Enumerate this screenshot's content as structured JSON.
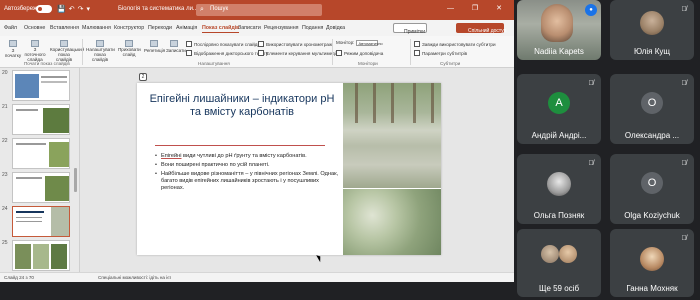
{
  "titlebar": {
    "autosave_label": "Автозбереження",
    "doc_title": "Біологія та систематика ли...",
    "search_placeholder": "Пошук",
    "window_controls": "— ❐ ✕"
  },
  "tabs": {
    "items": [
      "Файл",
      "Основне",
      "Вставлення",
      "Малювання",
      "Конструктор",
      "Переходи",
      "Анімація",
      "Показ слайдів",
      "Записати",
      "Рецензування",
      "Подання",
      "Довідка"
    ],
    "active": "Показ слайдів",
    "comments_label": "Примітки",
    "share_label": "Спільний доступ"
  },
  "ribbon": {
    "items": [
      "З початку",
      "З поточного слайда",
      "Користувацький показ слайдів",
      "Налаштувати показ слайдів",
      "Приховати слайд",
      "Репетиція",
      "Записати"
    ],
    "checkboxes": [
      "Послідовно показувати слайди",
      "Відображення дикторського тексту",
      "Використовувати хронометраж",
      "Елементи керування мультимедіа"
    ],
    "monitor_label": "Монітор:",
    "monitor_value": "Автоматично",
    "presenter_view": "Режим доповідача",
    "subtitles": [
      "Завжди використовувати субтитри",
      "Параметри субтитрів"
    ],
    "groups": [
      "Почати показ слайдів",
      "Налаштування",
      "Монітори",
      "Субтитри"
    ]
  },
  "thumbnails": [
    {
      "number": "20"
    },
    {
      "number": "21"
    },
    {
      "number": "22"
    },
    {
      "number": "23"
    },
    {
      "number": "24"
    },
    {
      "number": "25"
    }
  ],
  "page_badge": "2",
  "slide": {
    "title": "Епігейні лишайники – індикатори pH та вмісту карбонатів",
    "bullets": [
      {
        "underlined": "Епігейні",
        "rest": " види чутливі до рН ґрунту та вмісту карбонатів."
      },
      {
        "underlined": "",
        "rest": "Вони поширені практично по усій планеті."
      },
      {
        "underlined": "",
        "rest": "Найбільше видове різноманіття – у північних регіонах Землі. Однак, багато видів епігейних лишайників зростають і у посушливих регіонах."
      }
    ]
  },
  "statusbar": {
    "slide_info": "Слайд 24 з 70",
    "accessibility": "Спеціальні можливості: ідіть на ієї"
  },
  "participants": [
    {
      "name": "Nadiia Kapets",
      "type": "video",
      "muted": false,
      "speaking": true
    },
    {
      "name": "Юлія Кущ",
      "type": "photo",
      "muted": true
    },
    {
      "name": "Андрій Андрі...",
      "type": "initial",
      "initial": "А",
      "color": "#1e8e3e",
      "muted": true
    },
    {
      "name": "Олександра ...",
      "type": "initial",
      "initial": "О",
      "color": "#5f6368",
      "muted": true
    },
    {
      "name": "Ольга Позняк",
      "type": "photo",
      "muted": true
    },
    {
      "name": "Olga Koziychuk",
      "type": "initial",
      "initial": "O",
      "color": "#5f6368",
      "muted": true
    },
    {
      "name": "Ще 59 осіб",
      "type": "more",
      "muted": false
    },
    {
      "name": "Ганна Мохняк",
      "type": "photo",
      "muted": true
    }
  ]
}
